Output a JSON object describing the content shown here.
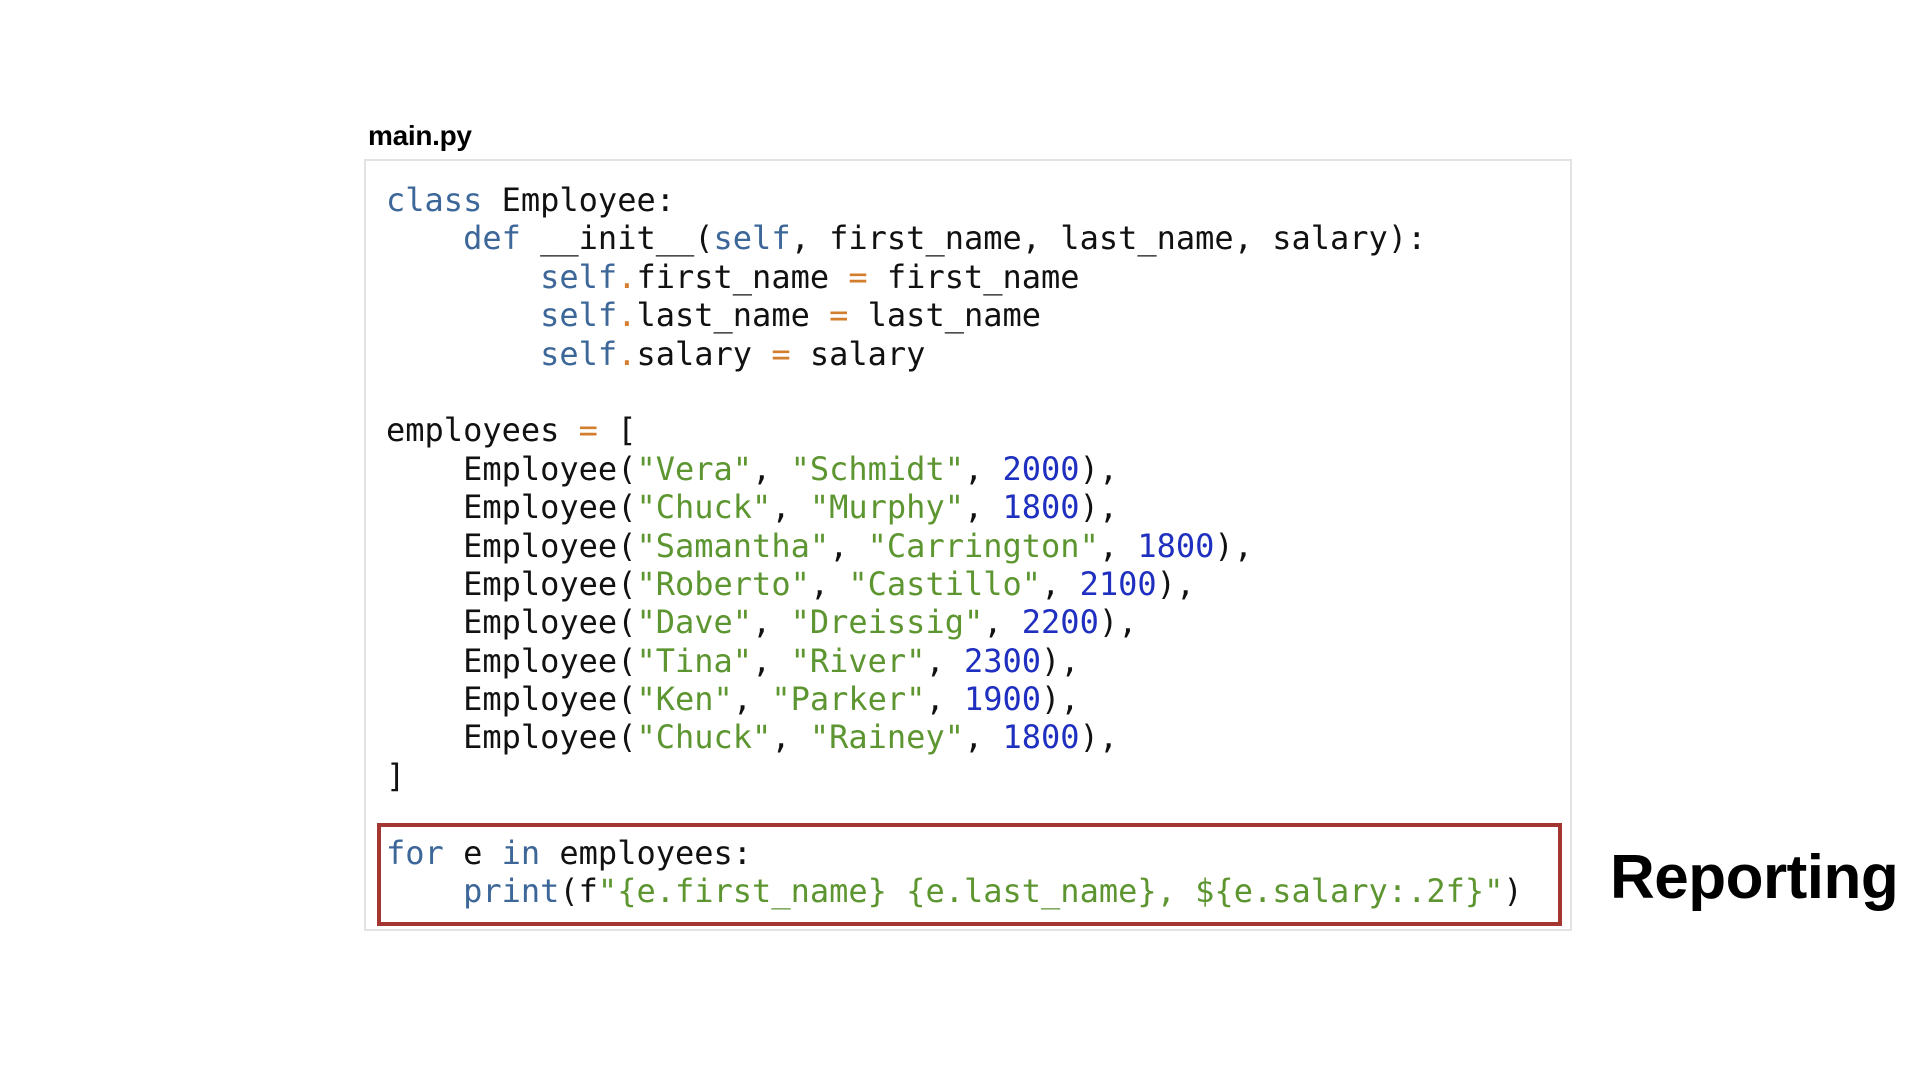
{
  "file": {
    "name": "main.py"
  },
  "colors": {
    "keyword": "#3d6799",
    "operator": "#d27e2e",
    "string": "#5d9631",
    "number": "#1f2fbf",
    "highlight_border": "#a33630"
  },
  "code": {
    "lines": [
      [
        [
          "kw",
          "class"
        ],
        [
          "t",
          " Employee:"
        ]
      ],
      [
        [
          "t",
          "    "
        ],
        [
          "kw",
          "def"
        ],
        [
          "t",
          " __init__("
        ],
        [
          "kw",
          "self"
        ],
        [
          "t",
          ", first_name, last_name, salary):"
        ]
      ],
      [
        [
          "t",
          "        "
        ],
        [
          "kw",
          "self"
        ],
        [
          "op",
          "."
        ],
        [
          "t",
          "first_name "
        ],
        [
          "op",
          "="
        ],
        [
          "t",
          " first_name"
        ]
      ],
      [
        [
          "t",
          "        "
        ],
        [
          "kw",
          "self"
        ],
        [
          "op",
          "."
        ],
        [
          "t",
          "last_name "
        ],
        [
          "op",
          "="
        ],
        [
          "t",
          " last_name"
        ]
      ],
      [
        [
          "t",
          "        "
        ],
        [
          "kw",
          "self"
        ],
        [
          "op",
          "."
        ],
        [
          "t",
          "salary "
        ],
        [
          "op",
          "="
        ],
        [
          "t",
          " salary"
        ]
      ],
      [
        [
          "t",
          ""
        ]
      ],
      [
        [
          "t",
          "employees "
        ],
        [
          "op",
          "="
        ],
        [
          "t",
          " ["
        ]
      ],
      [
        [
          "t",
          "    Employee("
        ],
        [
          "str",
          "\"Vera\""
        ],
        [
          "t",
          ", "
        ],
        [
          "str",
          "\"Schmidt\""
        ],
        [
          "t",
          ", "
        ],
        [
          "num",
          "2000"
        ],
        [
          "t",
          "),"
        ]
      ],
      [
        [
          "t",
          "    Employee("
        ],
        [
          "str",
          "\"Chuck\""
        ],
        [
          "t",
          ", "
        ],
        [
          "str",
          "\"Murphy\""
        ],
        [
          "t",
          ", "
        ],
        [
          "num",
          "1800"
        ],
        [
          "t",
          "),"
        ]
      ],
      [
        [
          "t",
          "    Employee("
        ],
        [
          "str",
          "\"Samantha\""
        ],
        [
          "t",
          ", "
        ],
        [
          "str",
          "\"Carrington\""
        ],
        [
          "t",
          ", "
        ],
        [
          "num",
          "1800"
        ],
        [
          "t",
          "),"
        ]
      ],
      [
        [
          "t",
          "    Employee("
        ],
        [
          "str",
          "\"Roberto\""
        ],
        [
          "t",
          ", "
        ],
        [
          "str",
          "\"Castillo\""
        ],
        [
          "t",
          ", "
        ],
        [
          "num",
          "2100"
        ],
        [
          "t",
          "),"
        ]
      ],
      [
        [
          "t",
          "    Employee("
        ],
        [
          "str",
          "\"Dave\""
        ],
        [
          "t",
          ", "
        ],
        [
          "str",
          "\"Dreissig\""
        ],
        [
          "t",
          ", "
        ],
        [
          "num",
          "2200"
        ],
        [
          "t",
          "),"
        ]
      ],
      [
        [
          "t",
          "    Employee("
        ],
        [
          "str",
          "\"Tina\""
        ],
        [
          "t",
          ", "
        ],
        [
          "str",
          "\"River\""
        ],
        [
          "t",
          ", "
        ],
        [
          "num",
          "2300"
        ],
        [
          "t",
          "),"
        ]
      ],
      [
        [
          "t",
          "    Employee("
        ],
        [
          "str",
          "\"Ken\""
        ],
        [
          "t",
          ", "
        ],
        [
          "str",
          "\"Parker\""
        ],
        [
          "t",
          ", "
        ],
        [
          "num",
          "1900"
        ],
        [
          "t",
          "),"
        ]
      ],
      [
        [
          "t",
          "    Employee("
        ],
        [
          "str",
          "\"Chuck\""
        ],
        [
          "t",
          ", "
        ],
        [
          "str",
          "\"Rainey\""
        ],
        [
          "t",
          ", "
        ],
        [
          "num",
          "1800"
        ],
        [
          "t",
          "),"
        ]
      ],
      [
        [
          "t",
          "]"
        ]
      ],
      [
        [
          "t",
          ""
        ]
      ],
      [
        [
          "kw",
          "for"
        ],
        [
          "t",
          " e "
        ],
        [
          "kw",
          "in"
        ],
        [
          "t",
          " employees:"
        ]
      ],
      [
        [
          "t",
          "    "
        ],
        [
          "kw",
          "print"
        ],
        [
          "t",
          "(f"
        ],
        [
          "str",
          "\"{e.first_name} {e.last_name}, ${e.salary:.2f}\""
        ],
        [
          "t",
          ")"
        ]
      ]
    ]
  },
  "annotation": {
    "label": "Reporting"
  }
}
